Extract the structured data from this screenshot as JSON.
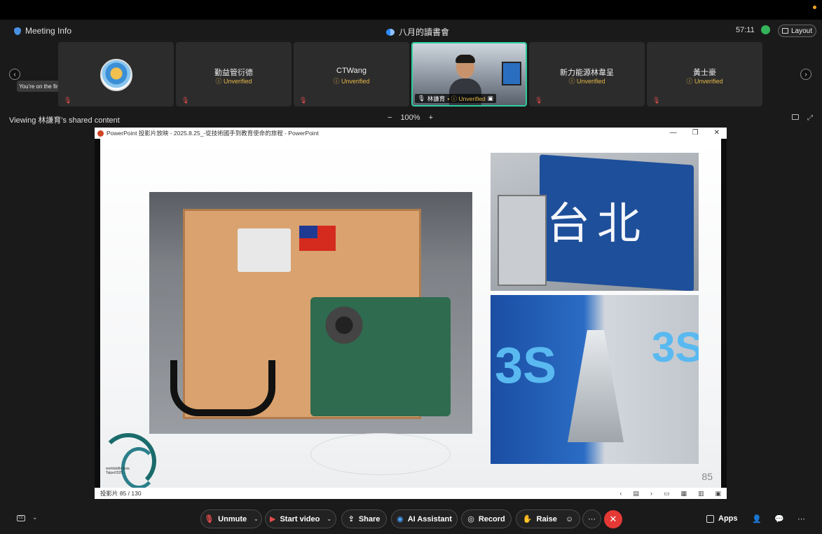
{
  "header": {
    "meeting_info": "Meeting Info",
    "meeting_title": "八月的讀書會",
    "timer": "57:11",
    "layout_label": "Layout"
  },
  "participants": {
    "tooltip": "You're on the first page",
    "tiles": [
      {
        "name": "",
        "status": "",
        "type": "avatar"
      },
      {
        "name": "勤益管衍德",
        "status": "Unverified",
        "type": "name"
      },
      {
        "name": "CTWang",
        "status": "Unverified",
        "type": "name"
      },
      {
        "name": "林謙育",
        "status": "Unverified",
        "type": "video"
      },
      {
        "name": "新力能源林韋呈",
        "status": "Unverified",
        "type": "name"
      },
      {
        "name": "黃士豪",
        "status": "Unverified",
        "type": "name"
      }
    ]
  },
  "share": {
    "viewing_label": "Viewing 林謙育's shared content",
    "zoom_minus": "−",
    "zoom_level": "100%",
    "zoom_plus": "+",
    "ppt_title": "PowerPoint 投影片放映  -  2025.8.25_-從技術國手到教育使命的旅程 - PowerPoint",
    "slide_counter": "投影片 85 / 130",
    "slide_page_number": "85",
    "sign_text": "台北",
    "banner_text": "3S",
    "logo_text": "worldskills Asia Taipei2025"
  },
  "toolbar": {
    "unmute": "Unmute",
    "start_video": "Start video",
    "share": "Share",
    "ai_assistant": "AI Assistant",
    "record": "Record",
    "raise": "Raise",
    "apps": "Apps"
  },
  "colors": {
    "accent": "#2ecc9f",
    "unverified": "#e6b84a",
    "end_call": "#e53935",
    "muted": "#e74c4c"
  }
}
